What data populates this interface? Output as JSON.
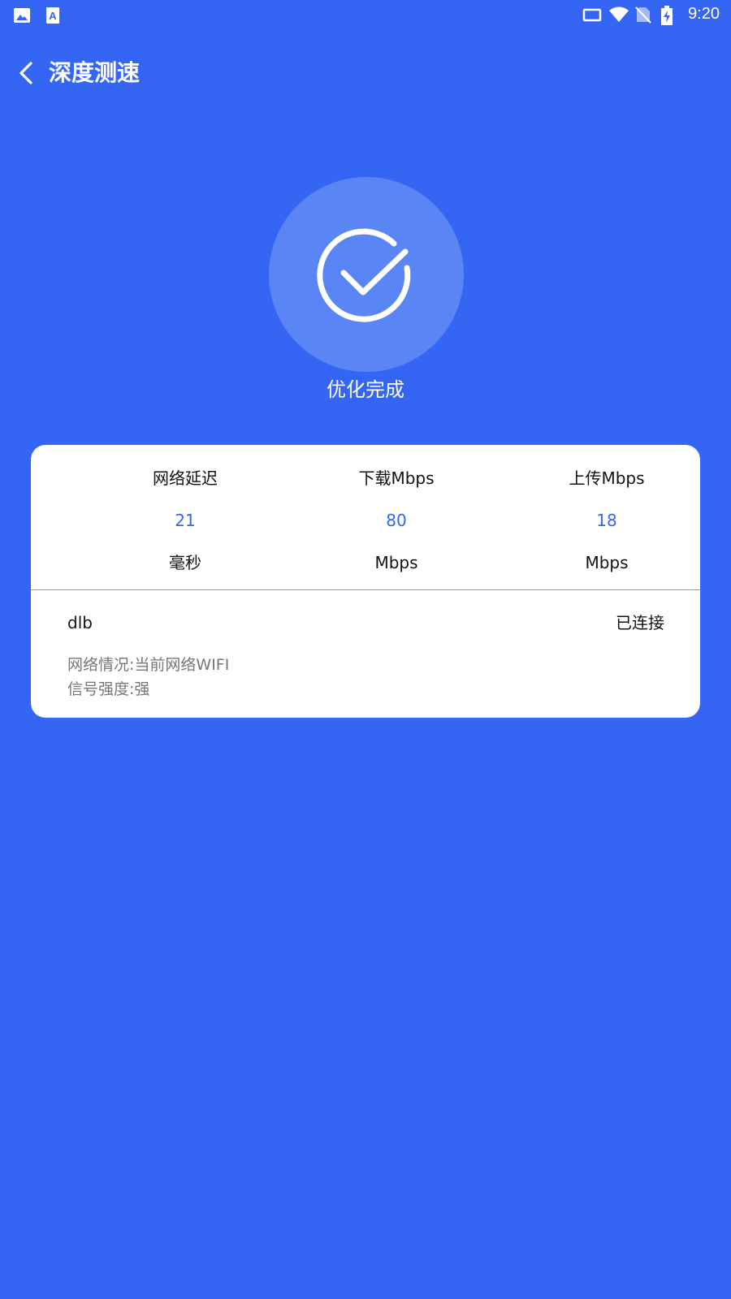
{
  "statusbar": {
    "time": "9:20",
    "left_icons": [
      "gallery-icon",
      "text-a-icon"
    ],
    "right_icons": [
      "cast-icon",
      "wifi-icon",
      "no-sim-icon",
      "battery-charging-icon"
    ]
  },
  "header": {
    "back_icon": "chevron-left-icon",
    "title": "深度测速"
  },
  "result": {
    "icon": "check-circle-icon",
    "status": "优化完成"
  },
  "metrics": [
    {
      "label": "网络延迟",
      "value": "21",
      "unit": "毫秒"
    },
    {
      "label": "下载Mbps",
      "value": "80",
      "unit": "Mbps"
    },
    {
      "label": "上传Mbps",
      "value": "18",
      "unit": "Mbps"
    }
  ],
  "network": {
    "name": "dlb",
    "status": "已连接",
    "info_type": "网络情况:当前网络WIFI",
    "info_strength": "信号强度:强"
  },
  "colors": {
    "background": "#3565F3",
    "circle": "#5A86F5",
    "value": "#3565F3",
    "card": "#FFFFFF"
  }
}
